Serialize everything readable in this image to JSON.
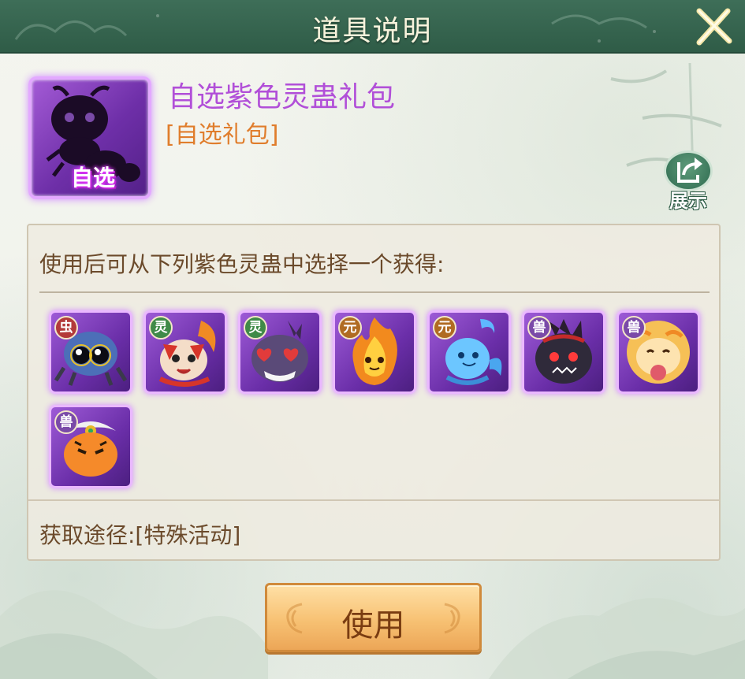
{
  "dialog": {
    "title": "道具说明",
    "close_icon": "close-x-icon"
  },
  "item": {
    "name": "自选紫色灵蛊礼包",
    "type": "[自选礼包]",
    "tag": "自选",
    "name_color": "#b14fd8",
    "type_color": "#e07d2c",
    "frame_color": "#6e2fa8"
  },
  "share": {
    "label": "展示",
    "icon": "share-arrow-icon"
  },
  "content": {
    "description": "使用后可从下列紫色灵蛊中选择一个获得:",
    "source": "获取途径:[特殊活动]"
  },
  "pets": [
    {
      "badge": "虫",
      "badge_color": "#b33a3a",
      "icon": "blue-spider-pet-icon"
    },
    {
      "badge": "灵",
      "badge_color": "#3f8a48",
      "icon": "fox-spirit-pet-icon"
    },
    {
      "badge": "灵",
      "badge_color": "#3f8a48",
      "icon": "purple-furball-pet-icon"
    },
    {
      "badge": "元",
      "badge_color": "#b06b22",
      "icon": "fire-spirit-pet-icon"
    },
    {
      "badge": "元",
      "badge_color": "#b06b22",
      "icon": "water-spirit-pet-icon"
    },
    {
      "badge": "兽",
      "badge_color": "#7a4aa8",
      "icon": "dark-beast-pet-icon"
    },
    {
      "badge": "兽",
      "badge_color": "#7a4aa8",
      "icon": "lion-dance-pet-icon"
    },
    {
      "badge": "兽",
      "badge_color": "#7a4aa8",
      "icon": "tiger-general-pet-icon"
    }
  ],
  "action": {
    "use_label": "使用"
  }
}
